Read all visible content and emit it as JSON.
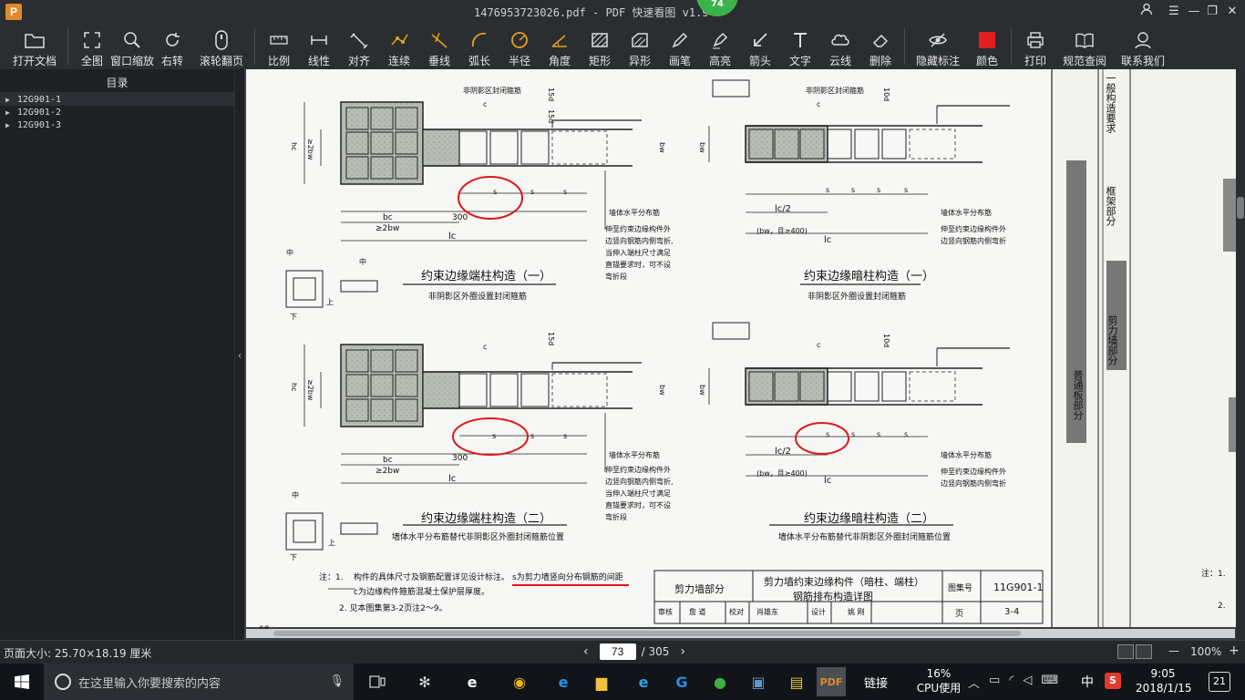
{
  "window": {
    "title": "1476953723026.pdf - PDF 快速看图 v1.9",
    "logo_letter": "P",
    "badge": "74"
  },
  "toolbar": [
    {
      "label": "打开文档",
      "icon": "folder-icon"
    },
    {
      "label": "全图",
      "icon": "fit-all-icon"
    },
    {
      "label": "窗口缩放",
      "icon": "zoom-icon"
    },
    {
      "label": "右转",
      "icon": "rotate-right-icon"
    },
    {
      "label": "滚轮翻页",
      "icon": "mouse-wheel-icon"
    },
    {
      "label": "比例",
      "icon": "scale-icon"
    },
    {
      "label": "线性",
      "icon": "linear-dimension-icon"
    },
    {
      "label": "对齐",
      "icon": "aligned-dimension-icon"
    },
    {
      "label": "连续",
      "icon": "continuous-dimension-icon"
    },
    {
      "label": "垂线",
      "icon": "perpendicular-icon"
    },
    {
      "label": "弧长",
      "icon": "arc-length-icon"
    },
    {
      "label": "半径",
      "icon": "radius-icon"
    },
    {
      "label": "角度",
      "icon": "angle-icon"
    },
    {
      "label": "矩形",
      "icon": "rectangle-area-icon"
    },
    {
      "label": "异形",
      "icon": "polygon-area-icon"
    },
    {
      "label": "画笔",
      "icon": "pen-icon"
    },
    {
      "label": "高亮",
      "icon": "highlighter-icon"
    },
    {
      "label": "箭头",
      "icon": "arrow-icon"
    },
    {
      "label": "文字",
      "icon": "text-icon"
    },
    {
      "label": "云线",
      "icon": "cloud-icon"
    },
    {
      "label": "删除",
      "icon": "eraser-icon"
    },
    {
      "label": "隐藏标注",
      "icon": "hide-annotation-icon"
    },
    {
      "label": "颜色",
      "icon": "color-icon",
      "color": "#e31e1e"
    },
    {
      "label": "打印",
      "icon": "print-icon"
    },
    {
      "label": "规范查阅",
      "icon": "book-icon"
    },
    {
      "label": "联系我们",
      "icon": "contact-icon"
    }
  ],
  "sidebar": {
    "header": "目录",
    "items": [
      {
        "label": "12G901-1"
      },
      {
        "label": "12G901-2"
      },
      {
        "label": "12G901-3"
      }
    ]
  },
  "document": {
    "titles": [
      "约束边缘端柱构造（一）",
      "约束边缘暗柱构造（一）",
      "约束边缘端柱构造（二）",
      "约束边缘暗柱构造（二）"
    ],
    "subtitles": [
      "非阴影区外圈设置封闭箍筋",
      "非阴影区外圈设置封闭箍筋",
      "墙体水平分布筋替代非阴影区外圈封闭箍筋位置",
      "墙体水平分布筋替代非阴影区外圈封闭箍筋位置"
    ],
    "labels": {
      "closed_stirrup": "非阴影区封闭箍筋",
      "wall_horizontal": "墙体水平分布筋",
      "note_extend": [
        "伸至约束边缘构件外",
        "边竖向钢筋内侧弯折,",
        "当伸入端柱尺寸满足",
        "直锚要求时，可不设",
        "弯折段"
      ],
      "note_extend_short": [
        "伸至约束边缘构件外",
        "边竖向钢筋内侧弯折"
      ],
      "dim_300": "300",
      "dim_bc": "bc",
      "dim_2bw": "≥2bw",
      "dim_lc": "lc",
      "dim_lc2": "lc/2",
      "dim_bw400": "(bw，且≥400)",
      "dim_s": "s",
      "dim_c": "c",
      "dim_15d": "15d",
      "dim_10d": "10d",
      "dim_hc": "hc",
      "dim_2bw_v": "≥2bw",
      "dim_bw": "bw",
      "mid": "中",
      "up": "上",
      "down": "下"
    },
    "notes": {
      "prefix": "注：1.",
      "n1": "构件的具体尺寸及钢筋配置详见设计标注。",
      "n1_red": "s为剪力墙竖向分布钢筋的间距",
      "n1b": "c为边缘构件箍筋混凝土保护层厚度。",
      "n2": "2. 见本图集第3-2页注2～9。"
    },
    "titleblock": {
      "section": "剪力墙部分",
      "name1": "剪力墙约束边缘构件（暗柱、端柱）",
      "name2": "钢筋排布构造详图",
      "set_label": "图集号",
      "set_no": "11G901-1",
      "page_label": "页",
      "page_no": "3-4",
      "row": [
        "审核",
        "詹 道",
        "校对",
        "肖雄东",
        "设计",
        "姚 刚"
      ]
    },
    "right_partial": {
      "side_text": [
        "一般构造要求",
        "框架部分",
        "剪力墙部分",
        "普通板部分"
      ],
      "notes": [
        "注：1.",
        "2."
      ],
      "page_corner": "68"
    }
  },
  "status": {
    "page_size": "页面大小: 25.70×18.19 厘米",
    "current_page": "73",
    "total_pages": "/ 305",
    "zoom": "100%",
    "zoom_minus": "—",
    "zoom_plus": "+"
  },
  "taskbar": {
    "search_placeholder": "在这里输入你要搜索的内容",
    "tray_link": "链接",
    "cpu_percent": "16%",
    "cpu_label": "CPU使用",
    "ime": "中",
    "time": "9:05",
    "date": "2018/1/15",
    "notifications": "21"
  }
}
